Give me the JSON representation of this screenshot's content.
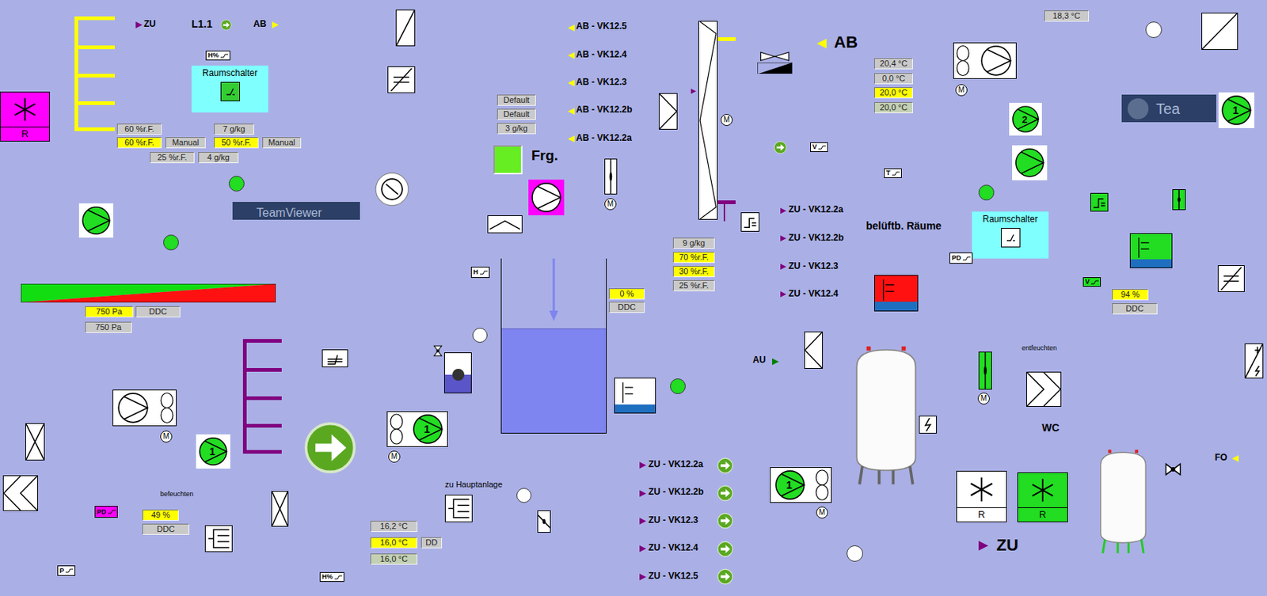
{
  "labels": [
    {
      "text": "ZU"
    },
    {
      "text": "L1.1"
    },
    {
      "text": "AB"
    },
    {
      "text": "befeuchten"
    },
    {
      "text": "zu Hauptanlage"
    },
    {
      "text": "Frg."
    },
    {
      "text": "AB"
    },
    {
      "text": "belüftb. Räume"
    },
    {
      "text": "AU"
    },
    {
      "text": "entfeuchten"
    },
    {
      "text": "WC"
    },
    {
      "text": "FO"
    },
    {
      "text": "ZU"
    }
  ],
  "release_indicator": {
    "on": true,
    "color": "#66ee22"
  },
  "fields": [
    {
      "text": "60 %r.F.",
      "kind": "grey"
    },
    {
      "text": "7 g/kg",
      "kind": "grey"
    },
    {
      "text": "60 %r.F.",
      "kind": "yellow"
    },
    {
      "text": "Manual",
      "kind": "grey"
    },
    {
      "text": "50 %r.F.",
      "kind": "yellow"
    },
    {
      "text": "Manual",
      "kind": "grey"
    },
    {
      "text": "25 %r.F.",
      "kind": "grey"
    },
    {
      "text": "4 g/kg",
      "kind": "grey"
    },
    {
      "text": "750 Pa",
      "kind": "yellow"
    },
    {
      "text": "DDC",
      "kind": "grey"
    },
    {
      "text": "750 Pa",
      "kind": "grey"
    },
    {
      "text": "49 %",
      "kind": "yellow"
    },
    {
      "text": "DDC",
      "kind": "grey"
    },
    {
      "text": "16,2 °C",
      "kind": "grey"
    },
    {
      "text": "16,0 °C",
      "kind": "yellow"
    },
    {
      "text": "DD",
      "kind": "grey"
    },
    {
      "text": "16,0 °C",
      "kind": "green"
    },
    {
      "text": "Default",
      "kind": "grey"
    },
    {
      "text": "Default",
      "kind": "grey"
    },
    {
      "text": "3 g/kg",
      "kind": "grey"
    },
    {
      "text": "0 %",
      "kind": "yellow"
    },
    {
      "text": "DDC",
      "kind": "grey"
    },
    {
      "text": "9 g/kg",
      "kind": "grey"
    },
    {
      "text": "70 %r.F.",
      "kind": "yellow"
    },
    {
      "text": "30 %r.F.",
      "kind": "yellow"
    },
    {
      "text": "25 %r.F.",
      "kind": "grey"
    },
    {
      "text": "20,4 °C",
      "kind": "grey"
    },
    {
      "text": "0,0 °C",
      "kind": "grey"
    },
    {
      "text": "20,0 °C",
      "kind": "yellow"
    },
    {
      "text": "20,0 °C",
      "kind": "green"
    },
    {
      "text": "18,3 °C",
      "kind": "grey"
    },
    {
      "text": "94 %",
      "kind": "yellow"
    },
    {
      "text": "DDC",
      "kind": "grey"
    }
  ],
  "ab_outlets": [
    "AB - VK12.5",
    "AB - VK12.4",
    "AB - VK12.3",
    "AB - VK12.2b",
    "AB - VK12.2a"
  ],
  "supply_rooms": [
    "ZU - VK12.2a",
    "ZU - VK12.2b",
    "ZU - VK12.3",
    "ZU - VK12.4"
  ],
  "supply_outlets": [
    "ZU - VK12.2a",
    "ZU - VK12.2b",
    "ZU - VK12.3",
    "ZU - VK12.4",
    "ZU - VK12.5"
  ],
  "room_switches": [
    {
      "title": "Raumschalter",
      "on": true
    },
    {
      "title": "Raumschalter",
      "on": false
    }
  ],
  "pumps": [
    {
      "kind": "pump",
      "number": "",
      "color": "#22dd22",
      "frame": "#ffffff"
    },
    {
      "kind": "pump",
      "number": "1",
      "color": "#22dd22",
      "frame": "#ffffff"
    },
    {
      "kind": "pump",
      "number": "2",
      "color": "#22dd22",
      "frame": "#ffffff"
    },
    {
      "kind": "pump",
      "number": "",
      "color": "#22dd22",
      "frame": "#ffffff"
    },
    {
      "kind": "pump",
      "number": "1",
      "color": "#22dd22",
      "frame": "#ffffff"
    },
    {
      "kind": "pump",
      "number": "",
      "color": "#ffffff",
      "frame": "#ff00ff"
    },
    {
      "kind": "dot",
      "number": "",
      "color": "#22dd22",
      "frame": ""
    },
    {
      "kind": "dot",
      "number": "",
      "color": "#22dd22",
      "frame": ""
    },
    {
      "kind": "dot",
      "number": "",
      "color": "#22dd22",
      "frame": ""
    },
    {
      "kind": "dot",
      "number": "",
      "color": "#22dd22",
      "frame": ""
    },
    {
      "kind": "dot",
      "number": "",
      "color": "#ffffff",
      "frame": ""
    },
    {
      "kind": "dot",
      "number": "",
      "color": "#ffffff",
      "frame": ""
    },
    {
      "kind": "dot",
      "number": "",
      "color": "#ffffff",
      "frame": ""
    },
    {
      "kind": "dot",
      "number": "",
      "color": "#ffffff",
      "frame": ""
    }
  ],
  "fan_units": [
    {
      "number": "",
      "color": "#ffffff"
    },
    {
      "number": "1",
      "color": "#22dd22"
    },
    {
      "number": "1",
      "color": "#22dd22"
    },
    {
      "number": "",
      "color": "#ffffff"
    }
  ],
  "motors": [
    {
      "label": "M"
    },
    {
      "label": "M"
    },
    {
      "label": "M"
    },
    {
      "label": "M"
    },
    {
      "label": "M"
    },
    {
      "label": "M"
    },
    {
      "label": "M"
    }
  ],
  "heaters": [
    {
      "label": "R",
      "color": "#ff00ff"
    },
    {
      "label": "R",
      "color": "#ffffff"
    },
    {
      "label": "R",
      "color": "#22dd22"
    }
  ],
  "sensors": [
    {
      "label": "H%",
      "color": "#ffffff"
    },
    {
      "label": "H",
      "color": "#ffffff"
    },
    {
      "label": "V",
      "color": "#ffffff"
    },
    {
      "label": "T",
      "color": "#ffffff"
    },
    {
      "label": "PD",
      "color": "#ffffff"
    },
    {
      "label": "V",
      "color": "#22dd22"
    },
    {
      "label": "PD",
      "color": "#ff00ff"
    },
    {
      "label": "P",
      "color": "#ffffff"
    },
    {
      "label": "H%",
      "color": "#ffffff"
    }
  ],
  "tank": {
    "level": 0.6
  },
  "watermarks": [
    {
      "text": "TeamViewer"
    },
    {
      "text": "Tea"
    }
  ]
}
